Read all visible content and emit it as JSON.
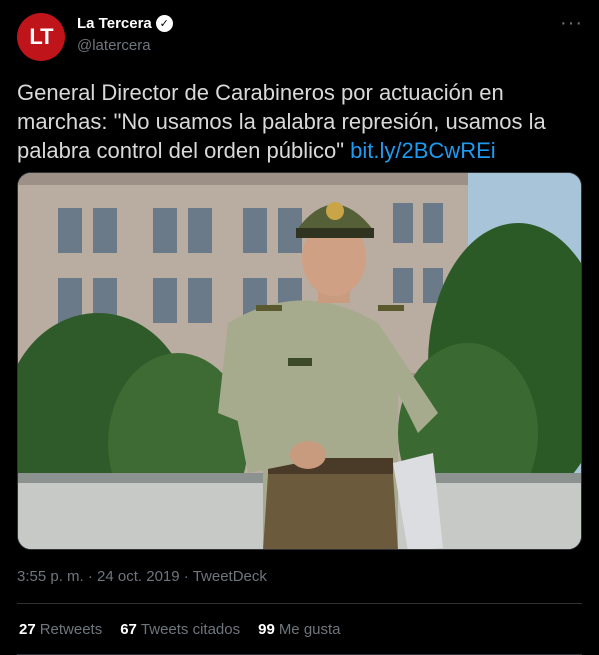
{
  "author": {
    "avatar_text": "LT",
    "name": "La Tercera",
    "handle": "@latercera",
    "verified_icon": "✓"
  },
  "more_icon": "···",
  "tweet": {
    "text": "General Director de Carabineros por actuación en marchas: \"No usamos la palabra represión, usamos la palabra control del orden público\"",
    "link": "bit.ly/2BCwREi"
  },
  "meta": {
    "time": "3:55 p. m.",
    "separator1": "·",
    "date": "24 oct. 2019",
    "separator2": "·",
    "source": "TweetDeck"
  },
  "stats": {
    "retweets_count": "27",
    "retweets_label": "Retweets",
    "quotes_count": "67",
    "quotes_label": "Tweets citados",
    "likes_count": "99",
    "likes_label": "Me gusta"
  },
  "colors": {
    "background": "#000000",
    "accent_link": "#1d9bf0",
    "avatar": "#c0141b",
    "secondary_text": "#6e767d"
  }
}
